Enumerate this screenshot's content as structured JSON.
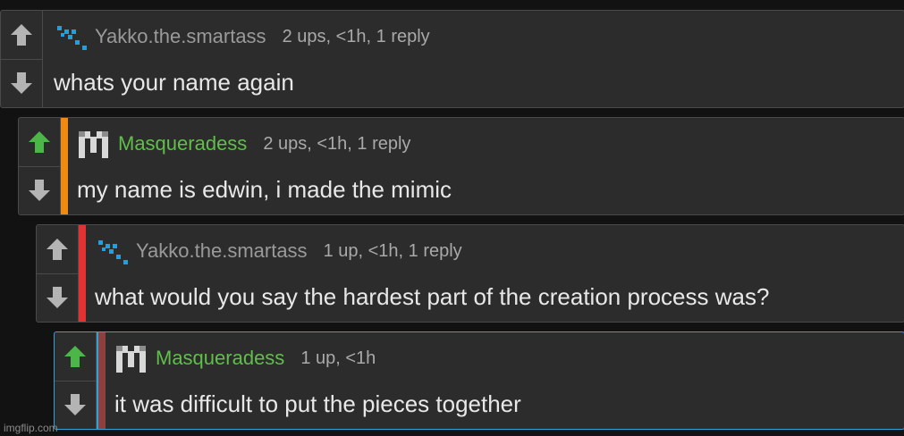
{
  "colors": {
    "background": "#121212",
    "card": "#2c2c2c",
    "upvote_active": "#4cb648",
    "vote_inactive": "#b4b4b4",
    "username_default": "#9a9a9a",
    "username_green": "#5fbf4a",
    "depth_orange": "#f08a10",
    "depth_red": "#e23232",
    "depth_maroon": "#8c4040",
    "highlight_border": "#2fa3d6"
  },
  "comments": [
    {
      "username": "Yakko.the.smartass",
      "stats": "2 ups, <1h, 1 reply",
      "text": "whats your name again",
      "upvoted": false,
      "avatar": "blue-pixel-avatar"
    },
    {
      "username": "Masqueradess",
      "stats": "2 ups, <1h, 1 reply",
      "text": "my name is edwin, i made the mimic",
      "upvoted": true,
      "avatar": "white-pixel-m-avatar"
    },
    {
      "username": "Yakko.the.smartass",
      "stats": "1 up, <1h, 1 reply",
      "text": "what would you say the hardest part of the creation process was?",
      "upvoted": false,
      "avatar": "blue-pixel-avatar"
    },
    {
      "username": "Masqueradess",
      "stats": "1 up, <1h",
      "text": "it was difficult to put the pieces together",
      "upvoted": true,
      "avatar": "white-pixel-m-avatar"
    }
  ],
  "watermark": "imgflip.com"
}
